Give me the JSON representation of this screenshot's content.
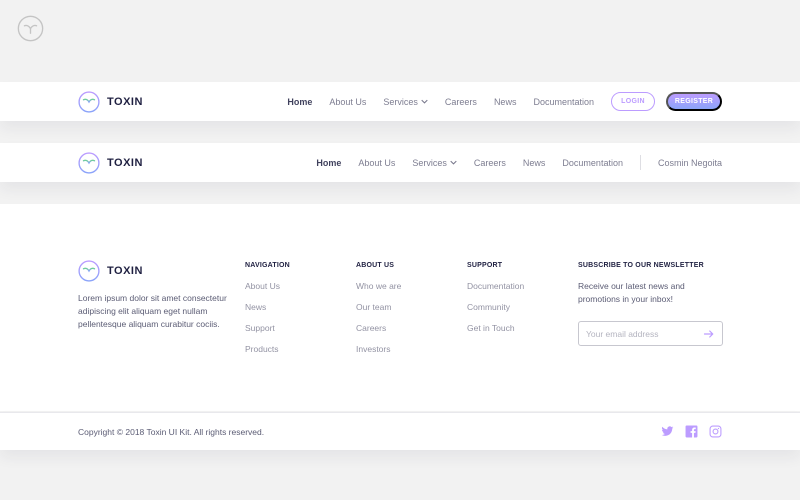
{
  "brand": {
    "name": "TOXIN",
    "icon": "toxin-logo-icon",
    "accent": "#bc9cff",
    "accent2": "#8ba4f9"
  },
  "header1": {
    "nav": [
      {
        "label": "Home",
        "active": true
      },
      {
        "label": "About Us"
      },
      {
        "label": "Services",
        "dropdown": true
      },
      {
        "label": "Careers"
      },
      {
        "label": "News"
      },
      {
        "label": "Documentation"
      }
    ],
    "login_label": "LOGIN",
    "register_label": "REGISTER"
  },
  "header2": {
    "nav": [
      {
        "label": "Home",
        "active": true
      },
      {
        "label": "About Us"
      },
      {
        "label": "Services",
        "dropdown": true
      },
      {
        "label": "Careers"
      },
      {
        "label": "News"
      },
      {
        "label": "Documentation"
      }
    ],
    "user_name": "Cosmin Negoita"
  },
  "footer": {
    "description": "Lorem ipsum dolor sit amet consectetur adipiscing elit aliquam eget nullam pellentesque aliquam curabitur cociis.",
    "columns": [
      {
        "title": "NAVIGATION",
        "links": [
          "About Us",
          "News",
          "Support",
          "Products"
        ]
      },
      {
        "title": "ABOUT US",
        "links": [
          "Who we are",
          "Our team",
          "Careers",
          "Investors"
        ]
      },
      {
        "title": "SUPPORT",
        "links": [
          "Documentation",
          "Community",
          "Get in Touch"
        ]
      }
    ],
    "newsletter": {
      "title": "SUBSCRIBE TO OUR NEWSLETTER",
      "text": "Receive our latest news and promotions in your inbox!",
      "placeholder": "Your email address",
      "submit_icon": "arrow-right-icon"
    }
  },
  "bottom": {
    "copyright": "Copyright © 2018 Toxin UI Kit. All rights reserved.",
    "social": [
      "twitter-icon",
      "facebook-icon",
      "instagram-icon"
    ]
  }
}
